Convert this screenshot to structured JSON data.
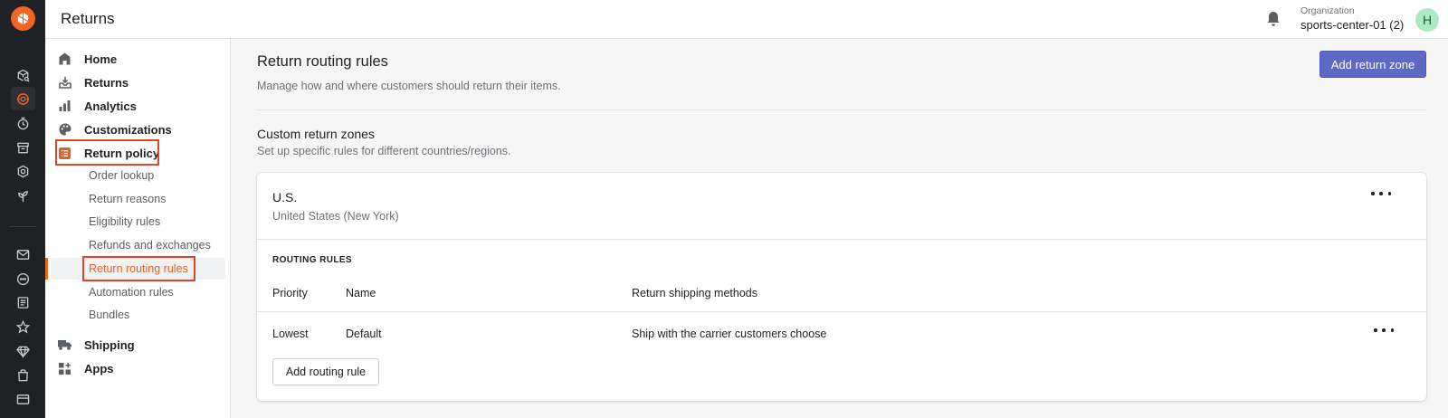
{
  "header": {
    "app_title": "Returns",
    "org_label": "Organization",
    "org_name": "sports-center-01 (2)",
    "avatar_initial": "H"
  },
  "nav": {
    "items": [
      {
        "label": "Home",
        "icon": "home-icon"
      },
      {
        "label": "Returns",
        "icon": "returns-icon"
      },
      {
        "label": "Analytics",
        "icon": "analytics-icon"
      },
      {
        "label": "Customizations",
        "icon": "palette-icon"
      },
      {
        "label": "Return policy",
        "icon": "policy-icon"
      },
      {
        "label": "Shipping",
        "icon": "truck-icon"
      },
      {
        "label": "Apps",
        "icon": "apps-icon"
      }
    ],
    "sub_items": [
      {
        "label": "Order lookup"
      },
      {
        "label": "Return reasons"
      },
      {
        "label": "Eligibility rules"
      },
      {
        "label": "Refunds and exchanges"
      },
      {
        "label": "Return routing rules",
        "active": true
      },
      {
        "label": "Automation rules"
      },
      {
        "label": "Bundles"
      }
    ]
  },
  "main": {
    "title": "Return routing rules",
    "subtitle": "Manage how and where customers should return their items.",
    "add_zone_label": "Add return zone",
    "section_title": "Custom return zones",
    "section_subtitle": "Set up specific rules for different countries/regions.",
    "zone": {
      "name": "U.S.",
      "region": "United States (New York)",
      "rules_label": "ROUTING RULES",
      "columns": [
        "Priority",
        "Name",
        "Return shipping methods"
      ],
      "rows": [
        {
          "priority": "Lowest",
          "name": "Default",
          "method": "Ship with the carrier customers choose"
        }
      ],
      "add_rule_label": "Add routing rule"
    }
  },
  "colors": {
    "brand_orange": "#f26522",
    "primary_button": "#5c6ac4",
    "highlight_box": "#e0452b",
    "rail_bg": "#1f2124"
  }
}
